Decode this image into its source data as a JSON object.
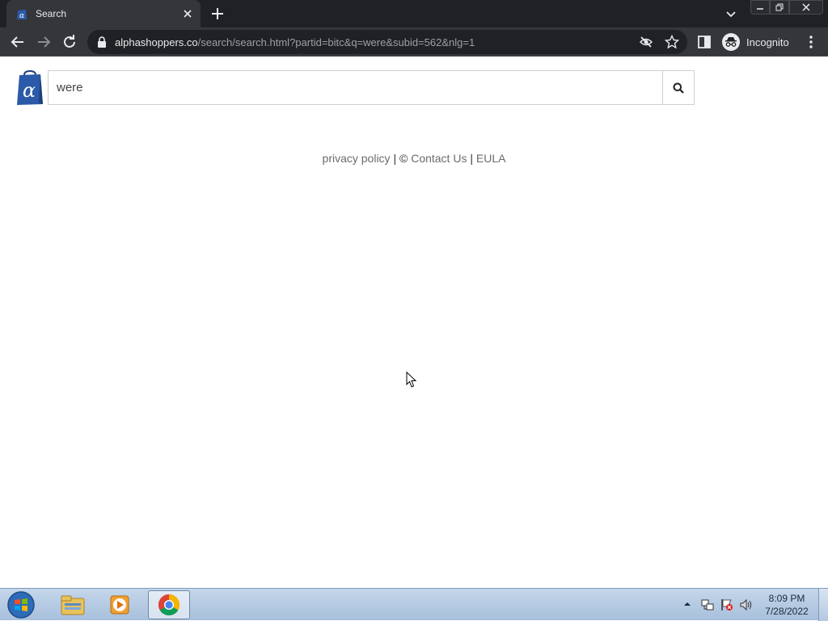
{
  "browser": {
    "tab": {
      "title": "Search"
    },
    "address": {
      "host": "alphashoppers.co",
      "path": "/search/search.html?partid=bitc&q=were&subid=562&nlg=1"
    },
    "profile_label": "Incognito"
  },
  "page": {
    "search": {
      "value": "were"
    },
    "footer": {
      "privacy_label": "privacy policy",
      "separator_1": "|",
      "copyright_symbol": "©",
      "contact_label": "Contact Us",
      "separator_2": "|",
      "eula_label": "EULA"
    },
    "colors": {
      "logo_blue": "#2a5aa8",
      "logo_dark": "#1d3f7a"
    }
  },
  "taskbar": {
    "apps": [
      "windows-explorer-icon",
      "media-player-icon",
      "chrome-icon"
    ],
    "active_app": "chrome",
    "clock": {
      "time": "8:09 PM",
      "date": "7/28/2022"
    }
  }
}
